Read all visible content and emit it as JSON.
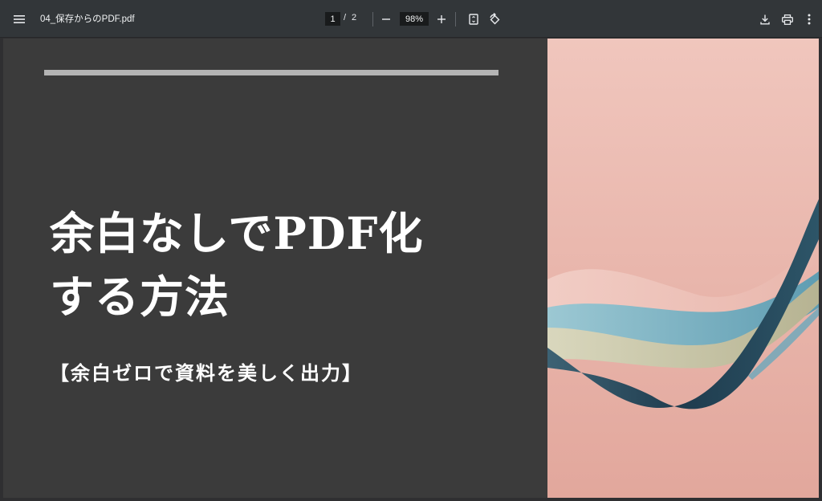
{
  "toolbar": {
    "filename": "04_保存からのPDF.pdf",
    "current_page": "1",
    "page_separator": "/",
    "total_pages": "2",
    "zoom": "98%"
  },
  "icons": [
    "menu-icon",
    "minus-icon",
    "plus-icon",
    "fit-page-icon",
    "rotate-icon",
    "download-icon",
    "print-icon",
    "more-vert-icon"
  ],
  "slide": {
    "title_line1": "余白なしでPDF化",
    "title_line2": "する方法",
    "subtitle": "【余白ゼロで資料を美しく出力】"
  },
  "colors": {
    "toolbar_bg": "#323639",
    "slide_bg": "#3b3b3b",
    "accent_bar": "#b4b4b4",
    "image_pink": "#ecb9b0",
    "ribbon_teal": "#7fb4c4",
    "ribbon_navy": "#2c4a5c",
    "ribbon_sage": "#c7c3a4"
  }
}
